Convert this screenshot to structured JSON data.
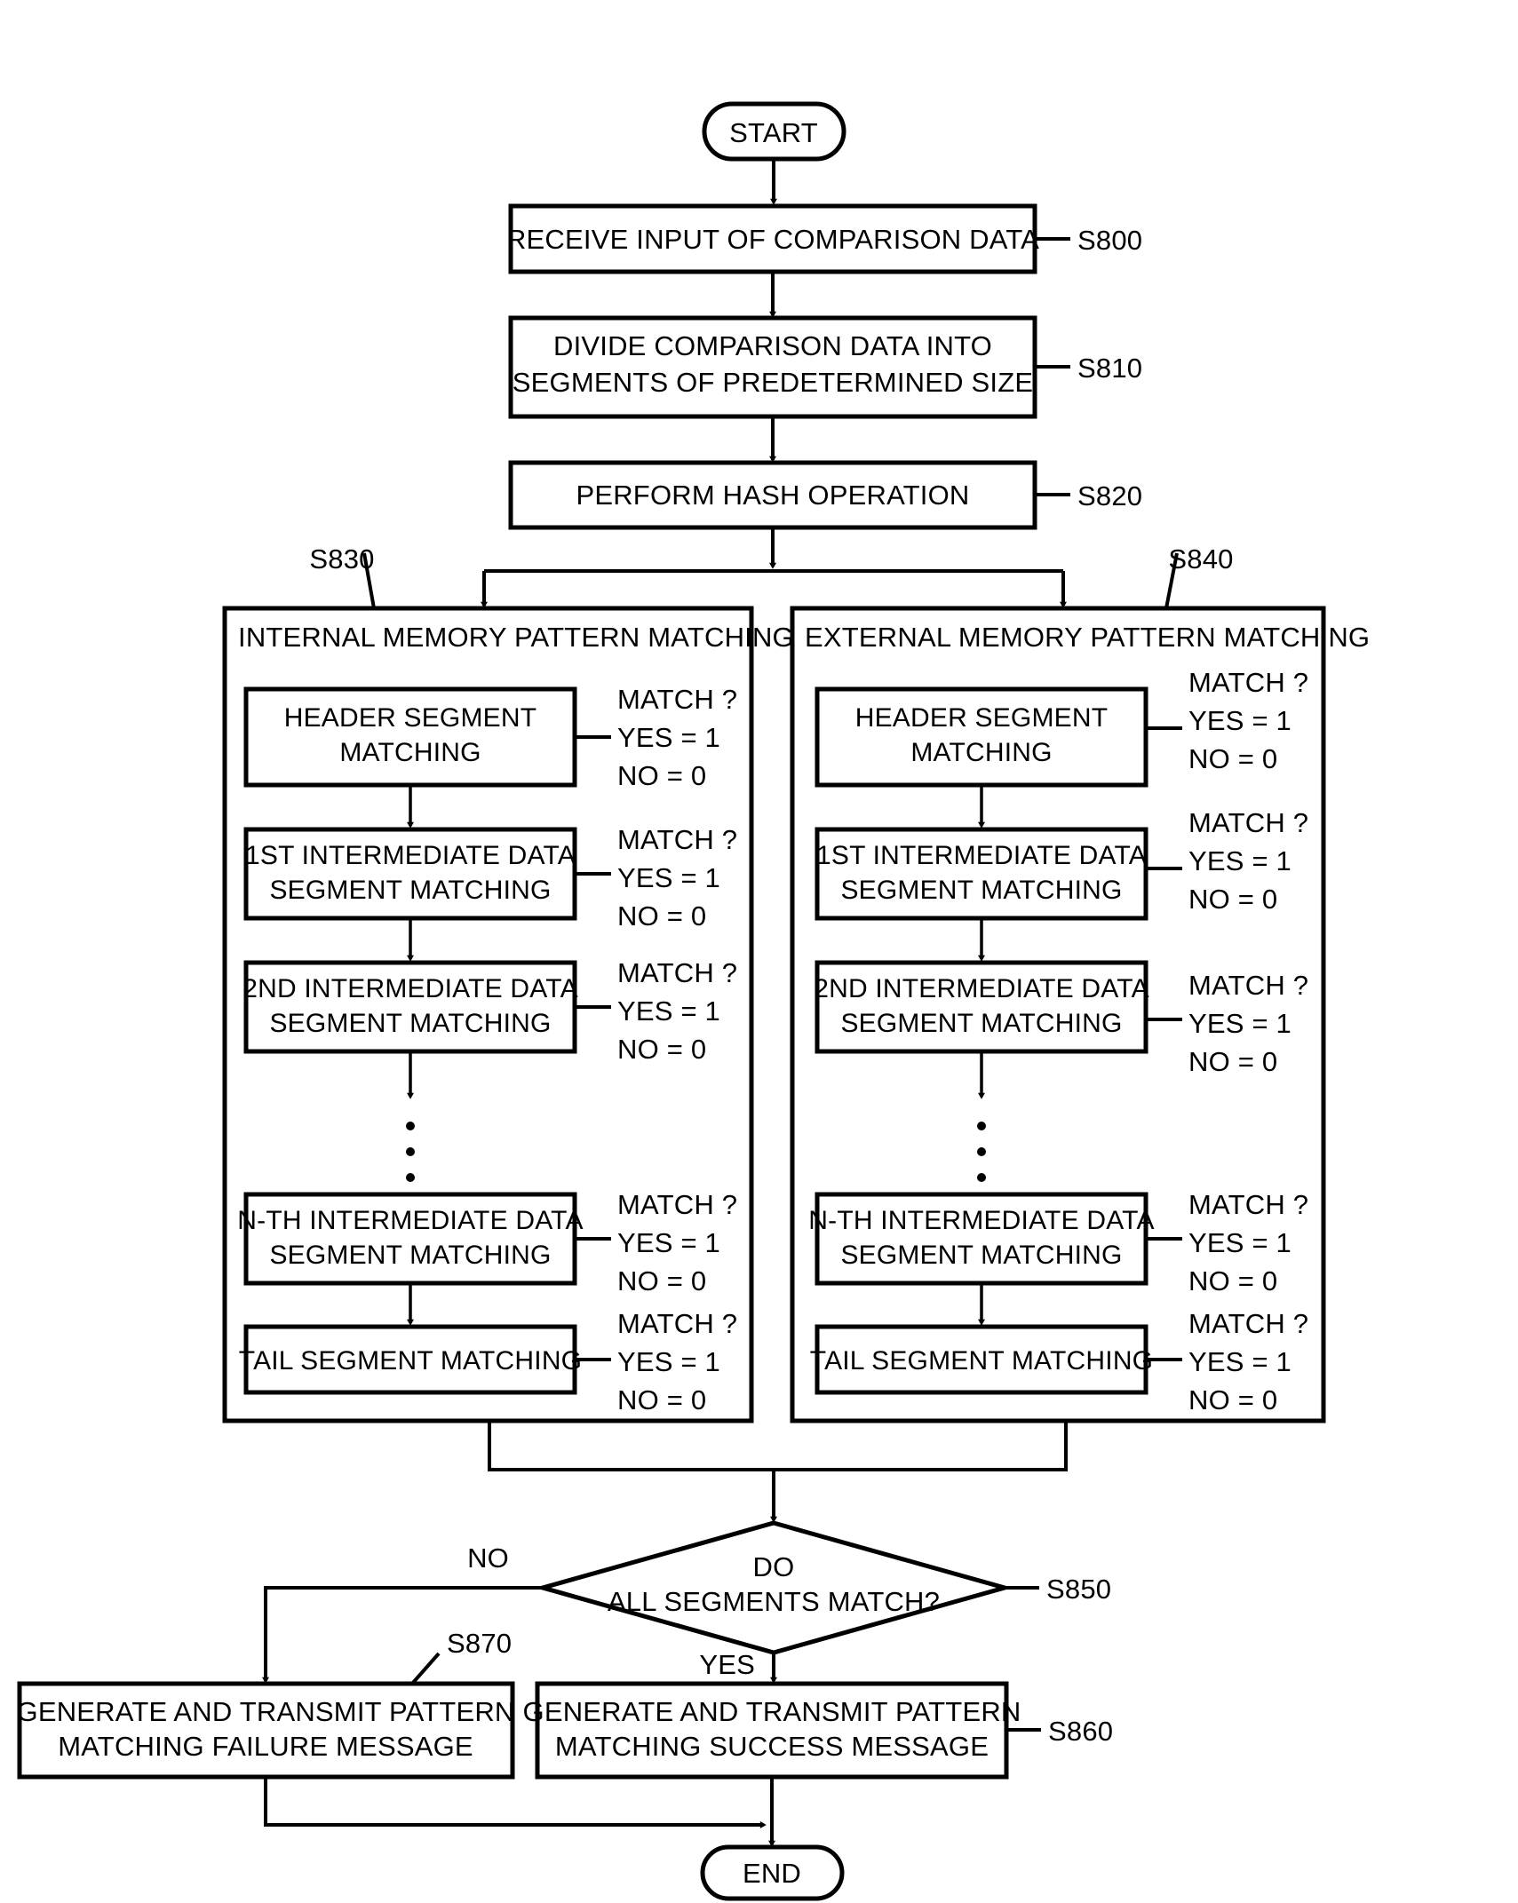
{
  "figure": {
    "type": "flowchart",
    "title": "Pattern matching process flowchart",
    "orientation": "vertical"
  },
  "terminals": {
    "start": "START",
    "end": "END"
  },
  "steps": [
    {
      "id": "S800",
      "label": "RECEIVE INPUT OF COMPARISON DATA",
      "ref": "S800"
    },
    {
      "id": "S810",
      "label_line1": "DIVIDE COMPARISON DATA INTO",
      "label_line2": "SEGMENTS OF PREDETERMINED SIZE",
      "ref": "S810"
    },
    {
      "id": "S820",
      "label": "PERFORM HASH OPERATION",
      "ref": "S820"
    }
  ],
  "panels": [
    {
      "ref": "S830",
      "title": "INTERNAL MEMORY PATTERN MATCHING",
      "boxes": [
        {
          "line1": "HEADER SEGMENT",
          "line2": "MATCHING"
        },
        {
          "line1": "1ST INTERMEDIATE DATA",
          "line2": "SEGMENT MATCHING"
        },
        {
          "line1": "2ND INTERMEDIATE DATA",
          "line2": "SEGMENT MATCHING"
        },
        {
          "line1": "N-TH INTERMEDIATE DATA",
          "line2": "SEGMENT MATCHING"
        },
        {
          "line1": "TAIL SEGMENT MATCHING",
          "line2": ""
        }
      ],
      "annotations": [
        {
          "q": "MATCH ?",
          "yes": "YES = 1",
          "no": "NO = 0"
        },
        {
          "q": "MATCH ?",
          "yes": "YES = 1",
          "no": "NO = 0"
        },
        {
          "q": "MATCH ?",
          "yes": "YES = 1",
          "no": "NO = 0"
        },
        {
          "q": "MATCH ?",
          "yes": "YES = 1",
          "no": "NO = 0"
        },
        {
          "q": "MATCH ?",
          "yes": "YES = 1",
          "no": "NO = 0"
        }
      ],
      "ellipsis": "vertical-dots"
    },
    {
      "ref": "S840",
      "title": "EXTERNAL MEMORY PATTERN MATCHING",
      "boxes": [
        {
          "line1": "HEADER SEGMENT",
          "line2": "MATCHING"
        },
        {
          "line1": "1ST INTERMEDIATE DATA",
          "line2": "SEGMENT MATCHING"
        },
        {
          "line1": "2ND INTERMEDIATE DATA",
          "line2": "SEGMENT MATCHING"
        },
        {
          "line1": "N-TH INTERMEDIATE DATA",
          "line2": "SEGMENT MATCHING"
        },
        {
          "line1": "TAIL SEGMENT MATCHING",
          "line2": ""
        }
      ],
      "annotations": [
        {
          "q": "MATCH ?",
          "yes": "YES = 1",
          "no": "NO = 0"
        },
        {
          "q": "MATCH ?",
          "yes": "YES = 1",
          "no": "NO = 0"
        },
        {
          "q": "MATCH ?",
          "yes": "YES = 1",
          "no": "NO = 0"
        },
        {
          "q": "MATCH ?",
          "yes": "YES = 1",
          "no": "NO = 0"
        },
        {
          "q": "MATCH ?",
          "yes": "YES = 1",
          "no": "NO = 0"
        }
      ],
      "ellipsis": "vertical-dots"
    }
  ],
  "decision": {
    "ref": "S850",
    "line1": "DO",
    "line2": "ALL SEGMENTS MATCH?",
    "branch_no": "NO",
    "branch_yes": "YES"
  },
  "outcomes": [
    {
      "ref": "S870",
      "line1": "GENERATE AND TRANSMIT PATTERN",
      "line2": "MATCHING FAILURE MESSAGE"
    },
    {
      "ref": "S860",
      "line1": "GENERATE AND TRANSMIT PATTERN",
      "line2": "MATCHING SUCCESS MESSAGE"
    }
  ],
  "colors": {
    "ink": "#000000",
    "paper": "#ffffff"
  }
}
